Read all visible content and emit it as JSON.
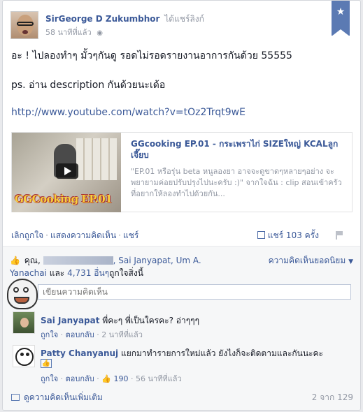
{
  "post": {
    "author": "SirGeorge D Zukumbhor",
    "action": "ได้แชร์ลิงก์",
    "time": "58 นาทีที่แล้ว",
    "text_line1": "อะ ! ไปลองทำๆ มั้วๆกันดู รอดไม่รอดรายงานอาการกันด้วย 55555",
    "text_line2": "ps. อ่าน description กันด้วยนะเด้อ",
    "link": "http://www.youtube.com/watch?v=tOz2Trqt9wE"
  },
  "share": {
    "thumb_brand": "GGCooking EP.01",
    "title": "GGcooking EP.01 - กระเพราไก่ SIZEใหญ่ KCALลูกเจี๊ยบ",
    "description": "\"EP.01 หรือรุ่น beta หนูลองยา อาจจะดูขาดๆหลายๆอย่าง จะพยายามค่อยปรับปรุงไปนะครับ :)\" จากใจฉัน : clip สอนเข้าครัว ที่อยากให้ลองทำไปด้วยกัน..."
  },
  "actions": {
    "unlike": "เลิกถูกใจ",
    "comment": "แสดงความคิดเห็น",
    "share": "แชร์",
    "share_count": "แชร์ 103 ครั้ง"
  },
  "likes": {
    "prefix": "คุณ,",
    "names": "Sai Janyapat, Um A. Yanachai",
    "and": "และ",
    "others": "4,731 อื่นๆ",
    "suffix": "ถูกใจสิ่งนี้",
    "sort": "ความคิดเห็นยอดนิยม"
  },
  "comment_box": {
    "placeholder": "เขียนความคิดเห็น"
  },
  "comments": [
    {
      "name": "Sai Janyapat",
      "text": "พี่คะๆ พี่เป็นใครคะ? อ่าๆๆๆ",
      "like": "ถูกใจ",
      "reply": "ตอบกลับ",
      "time": "2 นาทีที่แล้ว"
    },
    {
      "name": "Patty Chanyanuj",
      "text": "แยกมาทำรายการใหม่แล้ว ยังไงก็จะติดตามและกันนะคะ",
      "like": "ถูกใจ",
      "reply": "ตอบกลับ",
      "likes": "190",
      "time": "56 นาทีที่แล้ว"
    }
  ],
  "footer": {
    "more": "ดูความคิดเห็นเพิ่มเติม",
    "pager": "2 จาก 129"
  },
  "colors": {
    "link": "#3b5998",
    "muted": "#9197a3",
    "bookmark": "#5b7ab3"
  }
}
